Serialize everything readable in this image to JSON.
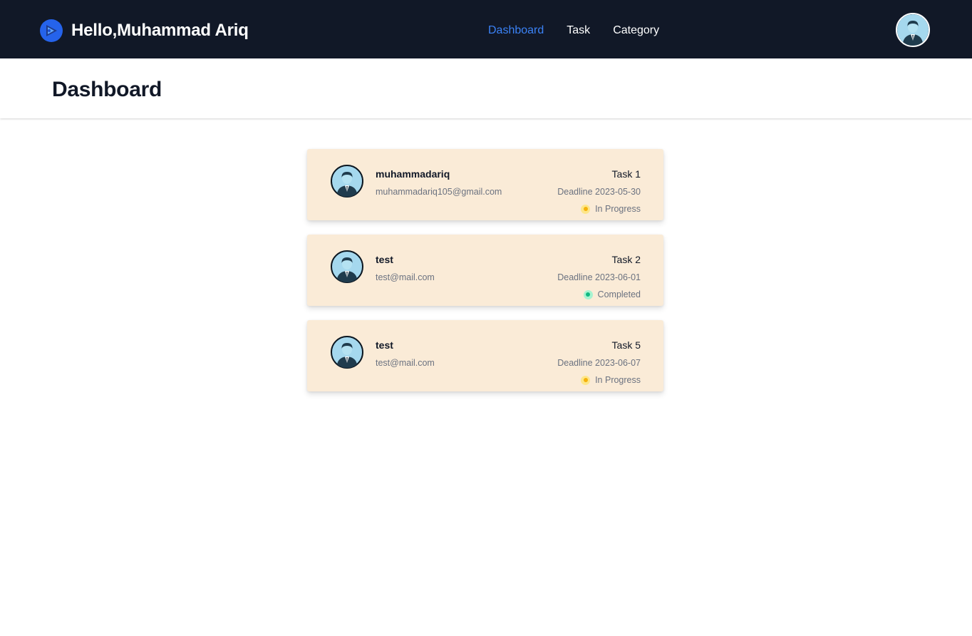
{
  "navbar": {
    "greeting": "Hello,Muhammad Ariq",
    "logo_icon": "brand-logo-icon",
    "links": [
      {
        "label": "Dashboard",
        "active": true
      },
      {
        "label": "Task",
        "active": false
      },
      {
        "label": "Category",
        "active": false
      }
    ],
    "avatar_icon": "user-avatar-icon"
  },
  "header": {
    "title": "Dashboard"
  },
  "tasks": [
    {
      "user_name": "muhammadariq",
      "user_email": "muhammadariq105@gmail.com",
      "task_name": "Task 1",
      "deadline": "Deadline 2023-05-30",
      "status": "In Progress",
      "status_color": "#f5b20b",
      "status_bg": "#fde68a"
    },
    {
      "user_name": "test",
      "user_email": "test@mail.com",
      "task_name": "Task 2",
      "deadline": "Deadline 2023-06-01",
      "status": "Completed",
      "status_color": "#10b981",
      "status_bg": "#a7f3d0"
    },
    {
      "user_name": "test",
      "user_email": "test@mail.com",
      "task_name": "Task 5",
      "deadline": "Deadline 2023-06-07",
      "status": "In Progress",
      "status_color": "#f5b20b",
      "status_bg": "#fde68a"
    }
  ],
  "colors": {
    "navbar_bg": "#111827",
    "active_link": "#3b82f6",
    "card_bg": "#faebd7"
  }
}
